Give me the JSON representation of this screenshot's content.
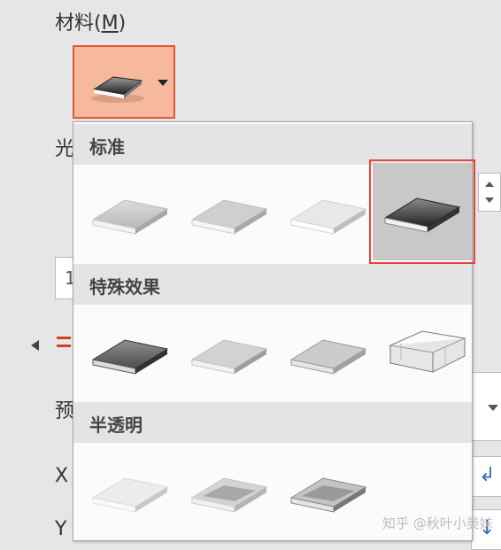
{
  "pane": {
    "material_label": "材料",
    "material_shortcut_open": "(",
    "material_shortcut_key": "M",
    "material_shortcut_close": ")",
    "light_label": "光",
    "preset_label": "预",
    "x_label": "X",
    "y_label": "Y",
    "input_fragment": "1"
  },
  "popup": {
    "sections": [
      {
        "label": "标准",
        "items": [
          {
            "name": "matte",
            "tone": "light-gray"
          },
          {
            "name": "warm-matte",
            "tone": "light-gray"
          },
          {
            "name": "plastic",
            "tone": "very-light"
          },
          {
            "name": "metal",
            "tone": "dark",
            "selected": true
          }
        ]
      },
      {
        "label": "特殊效果",
        "items": [
          {
            "name": "dark-edge",
            "tone": "mid-dark"
          },
          {
            "name": "soft-edge",
            "tone": "light-gray"
          },
          {
            "name": "flat",
            "tone": "light-gray"
          },
          {
            "name": "wireframe",
            "tone": "wireframe"
          }
        ]
      },
      {
        "label": "半透明",
        "items": [
          {
            "name": "powder",
            "tone": "translucent-light"
          },
          {
            "name": "clear",
            "tone": "translucent-mid"
          },
          {
            "name": "soft-metal",
            "tone": "translucent-dark"
          }
        ]
      }
    ]
  },
  "watermark": "知乎 @秋叶小美妹",
  "colors": {
    "selected_outline": "#e2473a",
    "material_button_bg": "#f6b99e",
    "section_header_bg": "#e4e4e4"
  }
}
